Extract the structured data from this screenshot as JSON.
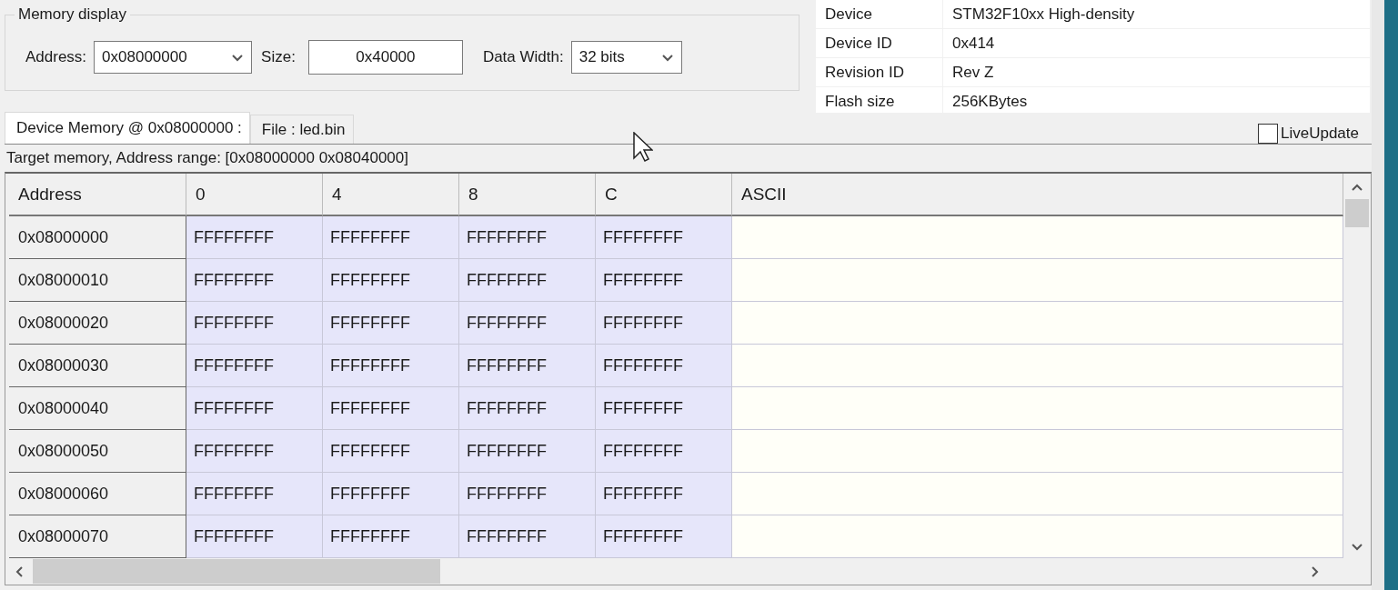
{
  "memory_display": {
    "title": "Memory display",
    "address": {
      "label": "Address:",
      "value": "0x08000000"
    },
    "size": {
      "label": "Size:",
      "value": "0x40000"
    },
    "data_width": {
      "label": "Data Width:",
      "value": "32 bits"
    }
  },
  "device_info": [
    {
      "label": "Device",
      "value": "STM32F10xx High-density"
    },
    {
      "label": "Device ID",
      "value": "0x414"
    },
    {
      "label": "Revision ID",
      "value": "Rev Z"
    },
    {
      "label": "Flash size",
      "value": "256KBytes"
    }
  ],
  "tabs": [
    {
      "label": "Device Memory @ 0x08000000 :",
      "selected": true
    },
    {
      "label": "File : led.bin",
      "selected": false
    }
  ],
  "live_update": {
    "label": "LiveUpdate",
    "checked": false
  },
  "range_text": "Target memory, Address range: [0x08000000 0x08040000]",
  "table": {
    "columns": [
      "Address",
      "0",
      "4",
      "8",
      "C",
      "ASCII"
    ],
    "rows": [
      [
        "0x08000000",
        "FFFFFFFF",
        "FFFFFFFF",
        "FFFFFFFF",
        "FFFFFFFF",
        ""
      ],
      [
        "0x08000010",
        "FFFFFFFF",
        "FFFFFFFF",
        "FFFFFFFF",
        "FFFFFFFF",
        ""
      ],
      [
        "0x08000020",
        "FFFFFFFF",
        "FFFFFFFF",
        "FFFFFFFF",
        "FFFFFFFF",
        ""
      ],
      [
        "0x08000030",
        "FFFFFFFF",
        "FFFFFFFF",
        "FFFFFFFF",
        "FFFFFFFF",
        ""
      ],
      [
        "0x08000040",
        "FFFFFFFF",
        "FFFFFFFF",
        "FFFFFFFF",
        "FFFFFFFF",
        ""
      ],
      [
        "0x08000050",
        "FFFFFFFF",
        "FFFFFFFF",
        "FFFFFFFF",
        "FFFFFFFF",
        ""
      ],
      [
        "0x08000060",
        "FFFFFFFF",
        "FFFFFFFF",
        "FFFFFFFF",
        "FFFFFFFF",
        ""
      ],
      [
        "0x08000070",
        "FFFFFFFF",
        "FFFFFFFF",
        "FFFFFFFF",
        "FFFFFFFF",
        ""
      ]
    ]
  }
}
